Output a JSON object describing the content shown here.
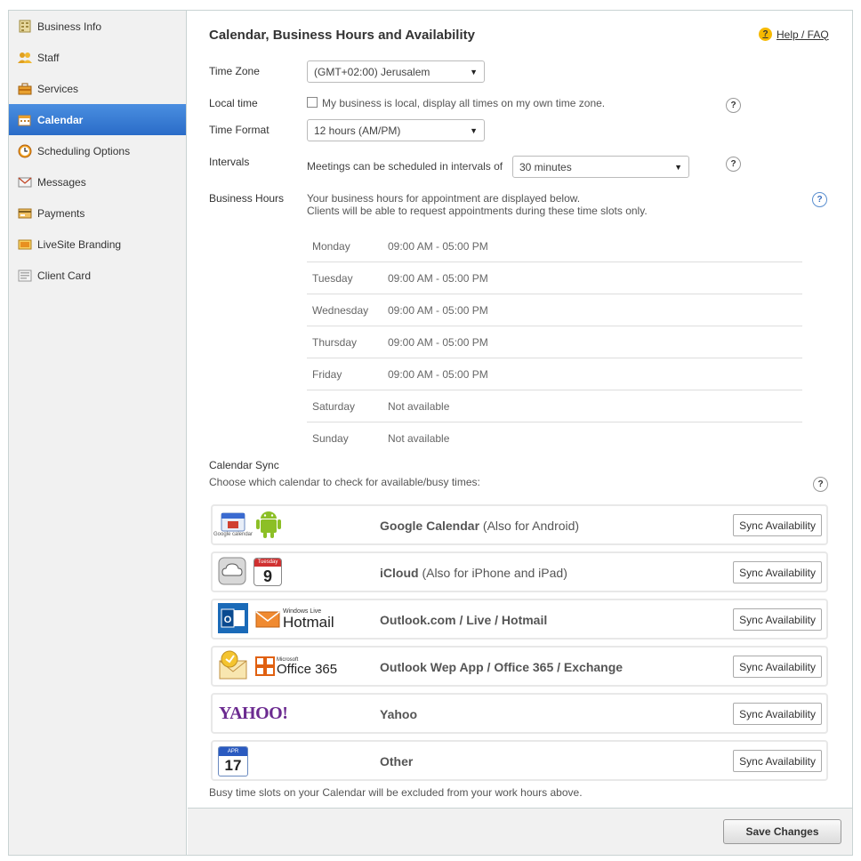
{
  "sidebar": {
    "items": [
      {
        "label": "Business Info",
        "icon": "business-info-icon"
      },
      {
        "label": "Staff",
        "icon": "staff-icon"
      },
      {
        "label": "Services",
        "icon": "services-icon"
      },
      {
        "label": "Calendar",
        "icon": "calendar-icon",
        "active": true
      },
      {
        "label": "Scheduling Options",
        "icon": "clock-icon"
      },
      {
        "label": "Messages",
        "icon": "envelope-icon"
      },
      {
        "label": "Payments",
        "icon": "payments-icon"
      },
      {
        "label": "LiveSite Branding",
        "icon": "branding-icon"
      },
      {
        "label": "Client Card",
        "icon": "client-card-icon"
      }
    ]
  },
  "header": {
    "title": "Calendar, Business Hours and Availability",
    "help_label": "Help / FAQ"
  },
  "settings": {
    "time_zone_label": "Time Zone",
    "time_zone_value": "(GMT+02:00) Jerusalem",
    "local_time_label": "Local time",
    "local_time_text": "My business is local, display all times on my own time zone.",
    "time_format_label": "Time Format",
    "time_format_value": "12 hours (AM/PM)",
    "intervals_label": "Intervals",
    "intervals_text": "Meetings can be scheduled in intervals of",
    "intervals_value": "30 minutes",
    "business_hours_label": "Business Hours",
    "business_hours_desc1": "Your business hours for appointment are displayed below.",
    "business_hours_desc2": "Clients will be able to request appointments during these time slots only."
  },
  "hours": [
    {
      "day": "Monday",
      "time": "09:00 AM - 05:00 PM"
    },
    {
      "day": "Tuesday",
      "time": "09:00 AM - 05:00 PM"
    },
    {
      "day": "Wednesday",
      "time": "09:00 AM - 05:00 PM"
    },
    {
      "day": "Thursday",
      "time": "09:00 AM - 05:00 PM"
    },
    {
      "day": "Friday",
      "time": "09:00 AM - 05:00 PM"
    },
    {
      "day": "Saturday",
      "time": "Not available"
    },
    {
      "day": "Sunday",
      "time": "Not available"
    }
  ],
  "sync": {
    "label": "Calendar Sync",
    "desc": "Choose which calendar to check for available/busy times:",
    "button_label": "Sync Availability",
    "note": "Busy time slots on your Calendar will be excluded from your work hours above.",
    "providers": [
      {
        "name": "Google Calendar",
        "suffix": "(Also for Android)",
        "logo1": "Google calendar",
        "logo2": "android-icon"
      },
      {
        "name": "iCloud",
        "suffix": "(Also for iPhone and iPad)",
        "logo1": "icloud-icon",
        "logo2_top": "Tuesday",
        "logo2_num": "9"
      },
      {
        "name": "Outlook.com / Live / Hotmail",
        "suffix": "",
        "logo2_small": "Windows Live",
        "logo2_text": "Hotmail"
      },
      {
        "name": "Outlook Wep App / Office 365 / Exchange",
        "suffix": "",
        "logo2_small": "Microsoft",
        "logo2_text": "Office 365"
      },
      {
        "name": "Yahoo",
        "suffix": "",
        "logo1": "YAHOO!"
      },
      {
        "name": "Other",
        "suffix": "",
        "logo1_top": "APR",
        "logo1_num": "17"
      }
    ]
  },
  "footer": {
    "save_label": "Save Changes"
  }
}
